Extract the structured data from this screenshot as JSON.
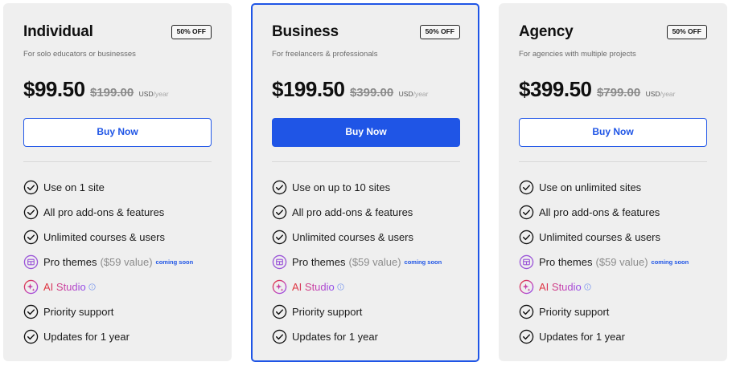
{
  "colors": {
    "accent": "#1f55e6",
    "card_bg": "#efefef",
    "ai_gradient": [
      "#e2332f",
      "#c341b8",
      "#8a4df0"
    ],
    "pro_theme_icon": "#9b55d8"
  },
  "plans": [
    {
      "name": "Individual",
      "badge": "50% OFF",
      "tagline": "For solo educators or businesses",
      "price": "$99.50",
      "old_price": "$199.00",
      "currency": "USD",
      "period": "/year",
      "button": "Buy Now",
      "features": {
        "sites": "Use on 1 site",
        "addons": "All pro add-ons & features",
        "courses": "Unlimited courses & users",
        "themes": "Pro themes",
        "themes_value": "($59 value)",
        "themes_soon": "coming soon",
        "ai": "AI Studio",
        "support": "Priority support",
        "updates": "Updates for 1 year"
      }
    },
    {
      "name": "Business",
      "badge": "50% OFF",
      "tagline": "For freelancers & professionals",
      "price": "$199.50",
      "old_price": "$399.00",
      "currency": "USD",
      "period": "/year",
      "button": "Buy Now",
      "features": {
        "sites": "Use on up to 10 sites",
        "addons": "All pro add-ons & features",
        "courses": "Unlimited courses & users",
        "themes": "Pro themes",
        "themes_value": "($59 value)",
        "themes_soon": "coming soon",
        "ai": "AI Studio",
        "support": "Priority support",
        "updates": "Updates for 1 year"
      }
    },
    {
      "name": "Agency",
      "badge": "50% OFF",
      "tagline": "For agencies with multiple projects",
      "price": "$399.50",
      "old_price": "$799.00",
      "currency": "USD",
      "period": "/year",
      "button": "Buy Now",
      "features": {
        "sites": "Use on unlimited sites",
        "addons": "All pro add-ons & features",
        "courses": "Unlimited courses & users",
        "themes": "Pro themes",
        "themes_value": "($59 value)",
        "themes_soon": "coming soon",
        "ai": "AI Studio",
        "support": "Priority support",
        "updates": "Updates for 1 year"
      }
    }
  ]
}
